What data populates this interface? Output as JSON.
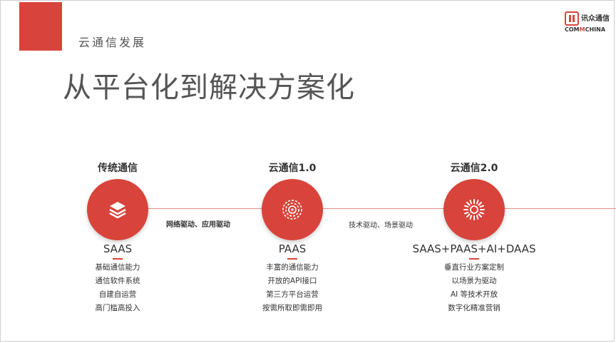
{
  "section_label": "云通信发展",
  "title": "从平台化到解决方案化",
  "logo": {
    "cn": "讯众通信",
    "en_part1": "COM",
    "en_part2": "M",
    "en_part3": "CHINA"
  },
  "stages": [
    {
      "title": "传统通信",
      "icon": "layers-icon",
      "model": "SAAS",
      "features": [
        "基础通信能力",
        "通信软件系统",
        "自建自运营",
        "高门槛高投入"
      ]
    },
    {
      "title": "云通信1.0",
      "icon": "spiral-icon",
      "model": "PAAS",
      "features": [
        "丰富的通信能力",
        "开放的API接口",
        "第三方平台运营",
        "按需所取即需即用"
      ]
    },
    {
      "title": "云通信2.0",
      "icon": "radial-icon",
      "model": "SAAS+PAAS+AI+DAAS",
      "features": [
        "垂直行业方案定制",
        "以场景为驱动",
        "AI 等技术开放",
        "数字化精准营销"
      ]
    }
  ],
  "connectors": [
    {
      "label": "网络驱动、应用驱动"
    },
    {
      "label": "技术驱动、场景驱动"
    }
  ],
  "colors": {
    "accent": "#d8443b",
    "text": "#333333",
    "title": "#555555"
  }
}
